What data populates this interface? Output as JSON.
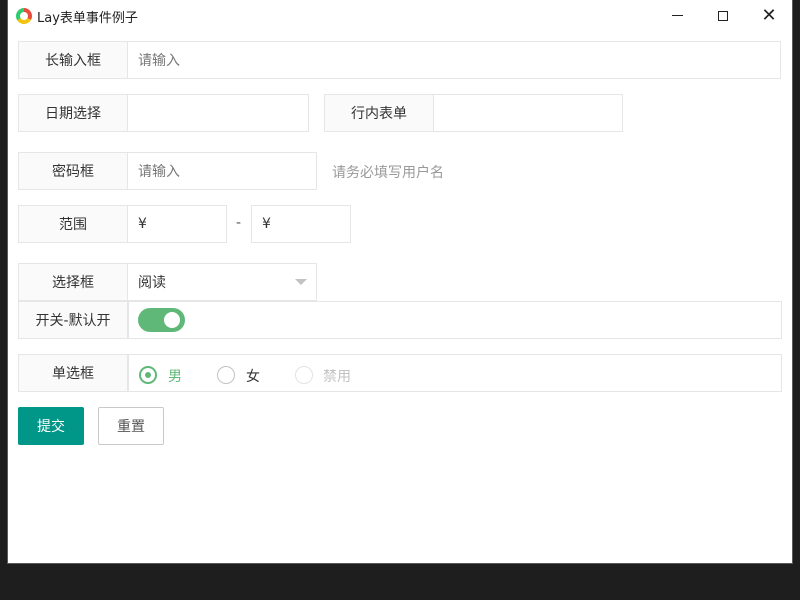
{
  "window": {
    "title": "Lay表单事件例子"
  },
  "form": {
    "long_input": {
      "label": "长输入框",
      "placeholder": "请输入"
    },
    "date": {
      "label": "日期选择",
      "value": ""
    },
    "inline": {
      "label": "行内表单",
      "value": ""
    },
    "password": {
      "label": "密码框",
      "placeholder": "请输入",
      "hint": "请务必填写用户名"
    },
    "range": {
      "label": "范围",
      "min_prefix": "¥",
      "separator": "-",
      "max_prefix": "¥"
    },
    "select": {
      "label": "选择框",
      "value": "阅读"
    },
    "switch": {
      "label": "开关-默认开",
      "on": true
    },
    "radio": {
      "label": "单选框",
      "options": [
        {
          "text": "男",
          "checked": true,
          "disabled": false
        },
        {
          "text": "女",
          "checked": false,
          "disabled": false
        },
        {
          "text": "禁用",
          "checked": false,
          "disabled": true
        }
      ]
    },
    "buttons": {
      "submit": "提交",
      "reset": "重置"
    }
  },
  "colors": {
    "primary": "#009688",
    "switch_on": "#5fb878",
    "radio_checked": "#5fb878"
  }
}
